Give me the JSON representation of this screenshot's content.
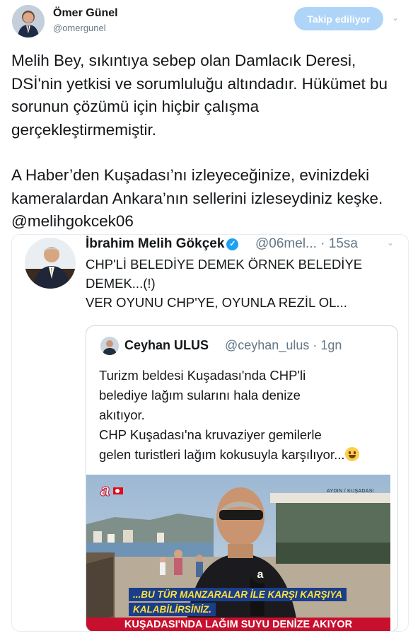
{
  "tweet": {
    "author_name": "Ömer Günel",
    "author_handle": "@omergunel",
    "follow_label": "Takip ediliyor",
    "paragraph_1": "Melih Bey, sıkıntıya sebep olan Damlacık Deresi, DSİ'nin yetkisi ve sorumluluğu altındadır. Hükümet bu sorunun çözümü için hiçbir çalışma gerçekleştirmemiştir.",
    "paragraph_2": "A Haber’den Kuşadası’nı izleyeceğinize, evinizdeki kameralardan Ankara’nın sellerini izleseydiniz keşke. @melihgokcek06"
  },
  "quoted": {
    "author_name": "İbrahim Melih Gökçek",
    "handle_time": "@06mel... · 15sa",
    "line_1": "CHP'Lİ BELEDİYE DEMEK ÖRNEK BELEDİYE",
    "line_2": "DEMEK...(!)",
    "line_3": "VER OYUNU CHP'YE, OYUNLA REZİL OL..."
  },
  "nested_quote": {
    "author_name": "Ceyhan ULUS",
    "handle_time": "@ceyhan_ulus · 1gn",
    "line_1": "Turizm beldesi Kuşadası'nda CHP'li",
    "line_2": "belediye lağım sularını hala denize",
    "line_3": "akıtıyor.",
    "line_4": "CHP Kuşadası'na kruvaziyer gemilerle",
    "line_5": "gelen turistleri lağım kokusuyla karşılıyor..."
  },
  "video": {
    "channel_logo": "a",
    "location_label": "AYDIN / KUŞADASI",
    "caption_1": "...BU TÜR MANZARALAR İLE KARŞI KARŞIYA",
    "caption_2": "KALABİLİRSİNİZ.",
    "banner": "KUŞADASI'NDA LAĞIM SUYU DENİZE AKIYOR"
  },
  "colors": {
    "follow_button_bg": "#aed4f8",
    "verified": "#1da1f2",
    "banner_red": "#c8102e",
    "caption_blue": "#1a3e8a",
    "caption_yellow": "#ffe23a"
  },
  "icons": [
    "chevron-down-icon",
    "verified-badge-icon",
    "smiley-emoji-icon",
    "microphone-icon"
  ]
}
